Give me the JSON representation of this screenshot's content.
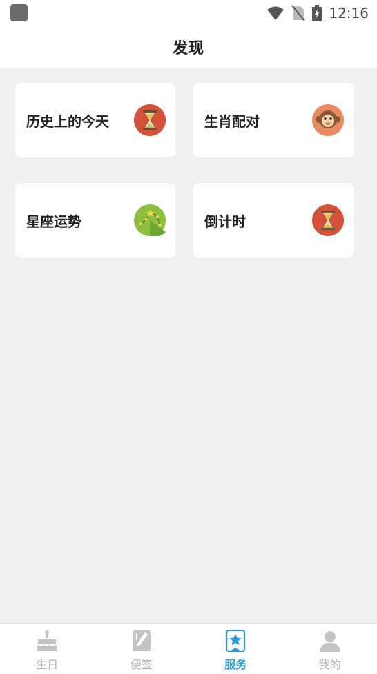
{
  "status_bar": {
    "time": "12:16",
    "icons": [
      "app-square-icon",
      "wifi-icon",
      "no-sim-icon",
      "battery-charging-icon"
    ]
  },
  "header": {
    "title": "发现"
  },
  "services": [
    {
      "label": "历史上的今天",
      "icon": "hourglass-icon"
    },
    {
      "label": "生肖配对",
      "icon": "monkey-icon"
    },
    {
      "label": "星座运势",
      "icon": "constellation-icon"
    },
    {
      "label": "倒计时",
      "icon": "hourglass-icon"
    }
  ],
  "tabbar": {
    "active": "服务",
    "active_color": "#2b9ad6",
    "inactive_color": "#b3b3b3",
    "tabs": [
      {
        "label": "生日",
        "icon": "cake-icon"
      },
      {
        "label": "便签",
        "icon": "note-icon"
      },
      {
        "label": "服务",
        "icon": "star-bookmark-icon"
      },
      {
        "label": "我的",
        "icon": "user-icon"
      }
    ]
  }
}
